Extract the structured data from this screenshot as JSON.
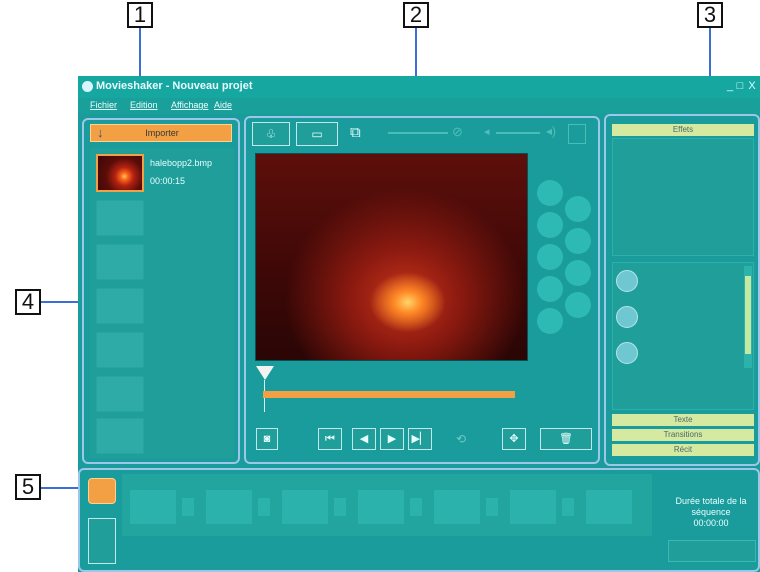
{
  "callouts": [
    "1",
    "2",
    "3",
    "4",
    "5"
  ],
  "window": {
    "title": "Movieshaker - Nouveau projet",
    "controls": [
      "_",
      "□",
      "X"
    ]
  },
  "menu": [
    "Fichier",
    "Edition",
    "Affichage",
    "Aide"
  ],
  "media": {
    "import_label": "Importer",
    "file_name": "halebopp2.bmp",
    "file_duration": "00:00:15"
  },
  "right_panel": {
    "effects": "Effets",
    "texte": "Texte",
    "transitions": "Transitions",
    "recit": "Récit"
  },
  "sequence": {
    "total_label": "Durée totale de la séquence",
    "total_time": "00:00:00"
  },
  "colors": {
    "app_bg": "#1a9c9c",
    "accent_orange": "#f3a045",
    "frame_blue": "#9cc7e8",
    "callout_line": "#3b6fd6"
  }
}
